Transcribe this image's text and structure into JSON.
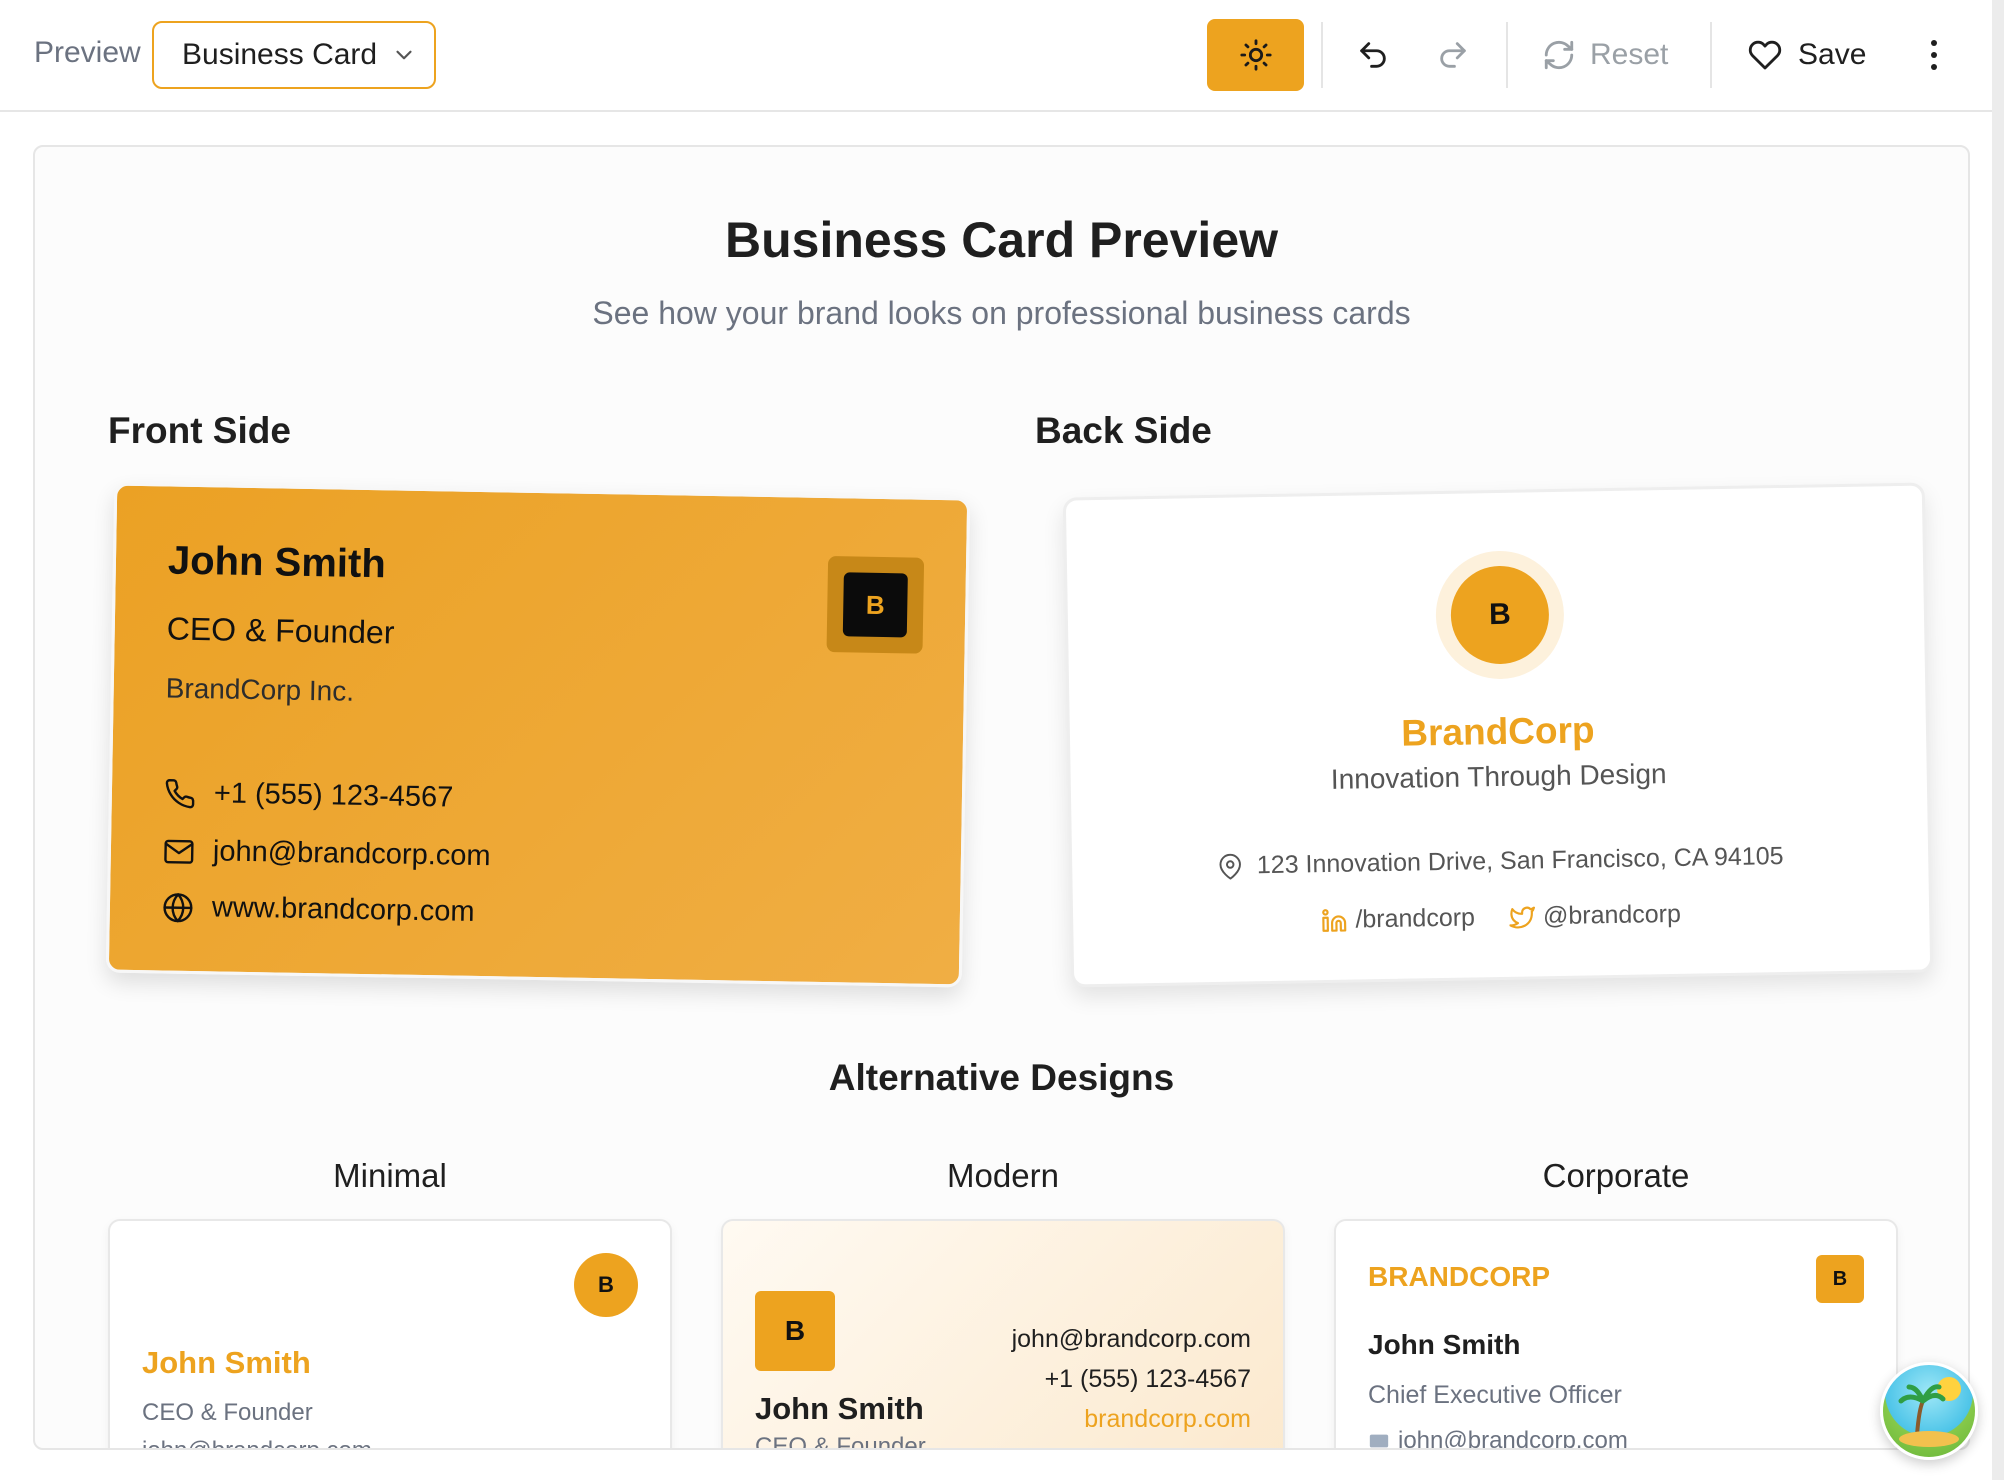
{
  "toolbar": {
    "preview_label": "Preview",
    "template_select": "Business Card",
    "reset_label": "Reset",
    "save_label": "Save",
    "icons": [
      "sun-icon",
      "undo-icon",
      "redo-icon",
      "refresh-icon",
      "heart-icon",
      "more-vertical-icon"
    ],
    "accent": "#eda31f"
  },
  "page": {
    "title": "Business Card Preview",
    "subtitle": "See how your brand looks on professional business cards",
    "front_label": "Front Side",
    "back_label": "Back Side",
    "alternatives_title": "Alternative Designs"
  },
  "front_card": {
    "name": "John Smith",
    "title": "CEO & Founder",
    "company": "BrandCorp Inc.",
    "logo_letter": "B",
    "phone": "+1 (555) 123-4567",
    "email": "john@brandcorp.com",
    "website": "www.brandcorp.com"
  },
  "back_card": {
    "logo_letter": "B",
    "brand": "BrandCorp",
    "tagline": "Innovation Through Design",
    "address": "123 Innovation Drive, San Francisco, CA 94105",
    "linkedin": "/brandcorp",
    "twitter": "@brandcorp"
  },
  "alternatives": {
    "minimal": {
      "label": "Minimal",
      "logo_letter": "B",
      "name": "John Smith",
      "title": "CEO & Founder",
      "email": "john@brandcorp.com"
    },
    "modern": {
      "label": "Modern",
      "logo_letter": "B",
      "name": "John Smith",
      "title": "CEO & Founder",
      "email": "john@brandcorp.com",
      "phone": "+1 (555) 123-4567",
      "website": "brandcorp.com"
    },
    "corporate": {
      "label": "Corporate",
      "brand": "BRANDCORP",
      "logo_letter": "B",
      "name": "John Smith",
      "title": "Chief Executive Officer",
      "email": "john@brandcorp.com"
    }
  }
}
